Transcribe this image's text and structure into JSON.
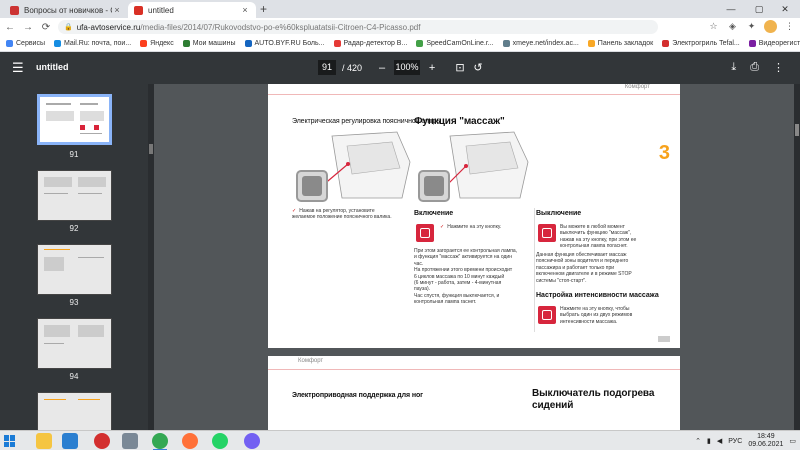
{
  "browser": {
    "tabs": [
      {
        "title": "Вопросы от новичков - Стран",
        "favicon_color": "#cc3333",
        "active": false
      },
      {
        "title": "untitled",
        "favicon_color": "#d93025",
        "active": true
      }
    ],
    "new_tab": "+",
    "url_host": "ufa-avtoservice.ru",
    "url_path": "/media-files/2014/07/Rukovodstvo-po-e%60kspluatatsii-Citroen-C4-Picasso.pdf"
  },
  "bookmarks": [
    {
      "label": "Сервисы",
      "color": "#4285f4"
    },
    {
      "label": "Mail.Ru: почта, пои...",
      "color": "#168de2"
    },
    {
      "label": "Яндекс",
      "color": "#fc3f1d"
    },
    {
      "label": "Мои машины",
      "color": "#2e7d32"
    },
    {
      "label": "AUTO.BYF.RU Боль...",
      "color": "#1565c0"
    },
    {
      "label": "Радар-детектор В...",
      "color": "#e53935"
    },
    {
      "label": "SpeedCamOnLine.r...",
      "color": "#43a047"
    },
    {
      "label": "xmeye.net/index.ac...",
      "color": "#607d8b"
    },
    {
      "label": "Панель закладок",
      "color": "#f9a825"
    },
    {
      "label": "Электрогриль Tefal...",
      "color": "#d32f2f"
    },
    {
      "label": "Видеорегистратор...",
      "color": "#7b1fa2"
    }
  ],
  "pdf_toolbar": {
    "menu_icon": "menu-icon",
    "title": "untitled",
    "current_page": "91",
    "total_pages": "/ 420",
    "zoom": "100%",
    "minus": "–",
    "plus": "+"
  },
  "thumbnails": [
    {
      "num": "91",
      "selected": true
    },
    {
      "num": "92",
      "selected": false
    },
    {
      "num": "93",
      "selected": false
    },
    {
      "num": "94",
      "selected": false
    }
  ],
  "page1": {
    "header": "Комфорт",
    "chapter": "3",
    "left": {
      "title": "Электрическая регулировка поясничной опоры",
      "text": "Нажав на регулятор, установите желаемое положение поясничного валика."
    },
    "right": {
      "title": "Функция \"массаж\"",
      "on": {
        "title": "Включение",
        "press": "Нажмите на эту кнопку.",
        "text": [
          "При этом загорается ее контрольная лампа,",
          "и функция \"массаж\" активируется на один",
          "час.",
          "На протяжении этого времени происходит",
          "6 циклов массажа по 10 минут каждый",
          "(6 минут - работа, затем - 4-минутная",
          "пауза).",
          "Час спустя, функция выключается, и",
          "контрольная лампа гаснет."
        ]
      },
      "off": {
        "title": "Выключение",
        "text": [
          "Вы можете в любой момент",
          "выключить функцию \"массаж\",",
          "нажав на эту кнопку, при этом ее",
          "контрольная лампа погаснет."
        ],
        "note": [
          "Данная функция обеспечивает массаж",
          "поясничной зоны водителя и переднего",
          "пассажира и работает только при",
          "включенном двигателе и в режиме STOP",
          "системы \"стоп-старт\"."
        ]
      },
      "intensity": {
        "title": "Настройка интенсивности массажа",
        "text": [
          "Нажмите на эту кнопку, чтобы",
          "выбрать один из двух режимов",
          "интенсивности массажа."
        ]
      }
    }
  },
  "page2": {
    "header": "Комфорт",
    "left_title": "Электроприводная поддержка для ног",
    "right_title_1": "Выключатель подогрева",
    "right_title_2": "сидений"
  },
  "taskbar": {
    "lang": "РУС",
    "time": "18:49",
    "date": "09.06.2021"
  }
}
